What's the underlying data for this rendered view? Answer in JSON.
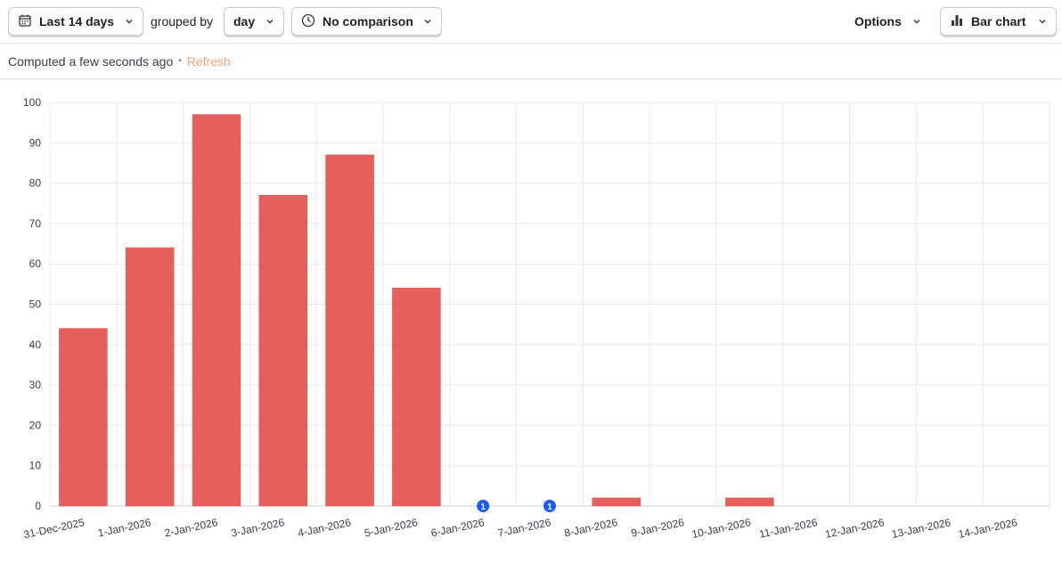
{
  "toolbar": {
    "date_range": "Last 14 days",
    "grouped_by_label": "grouped by",
    "interval": "day",
    "comparison": "No comparison",
    "options_label": "Options",
    "chart_type_label": "Bar chart"
  },
  "status": {
    "computed_text": "Computed a few seconds ago",
    "separator": "•",
    "refresh_label": "Refresh"
  },
  "colors": {
    "bar": "#e5605c",
    "annotation": "#1a5cff",
    "refresh": "#f1a07e"
  },
  "chart_data": {
    "type": "bar",
    "categories": [
      "31-Dec-2025",
      "1-Jan-2026",
      "2-Jan-2026",
      "3-Jan-2026",
      "4-Jan-2026",
      "5-Jan-2026",
      "6-Jan-2026",
      "7-Jan-2026",
      "8-Jan-2026",
      "9-Jan-2026",
      "10-Jan-2026",
      "11-Jan-2026",
      "12-Jan-2026",
      "13-Jan-2026",
      "14-Jan-2026"
    ],
    "values": [
      44,
      64,
      97,
      77,
      87,
      54,
      0,
      0,
      2,
      0,
      2,
      0,
      0,
      0,
      0
    ],
    "ylim": [
      0,
      100
    ],
    "yticks": [
      0,
      10,
      20,
      30,
      40,
      50,
      60,
      70,
      80,
      90,
      100
    ],
    "grid": true,
    "annotations": [
      {
        "category": "6-Jan-2026",
        "label": "1"
      },
      {
        "category": "7-Jan-2026",
        "label": "1"
      }
    ]
  }
}
